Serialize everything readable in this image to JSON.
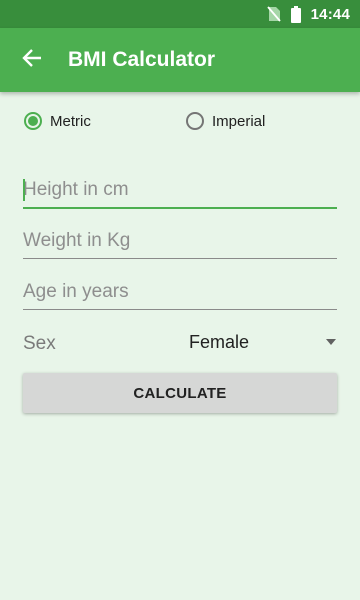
{
  "status_bar": {
    "time": "14:44",
    "icons": [
      "no-sim-icon",
      "battery-icon"
    ]
  },
  "app_bar": {
    "title": "BMI Calculator",
    "back_icon": "arrow-back-icon",
    "color": "#4caf50",
    "status_color": "#388e3c"
  },
  "units": {
    "options": [
      {
        "label": "Metric",
        "checked": true
      },
      {
        "label": "Imperial",
        "checked": false
      }
    ]
  },
  "form": {
    "height": {
      "placeholder": "Height in cm",
      "value": ""
    },
    "weight": {
      "placeholder": "Weight in Kg",
      "value": ""
    },
    "age": {
      "placeholder": "Age in years",
      "value": ""
    },
    "sex": {
      "label": "Sex",
      "selected": "Female"
    }
  },
  "calculate_button": {
    "label": "CALCULATE"
  },
  "colors": {
    "background": "#e8f5e9",
    "accent": "#4caf50",
    "button": "#d6d7d6"
  }
}
